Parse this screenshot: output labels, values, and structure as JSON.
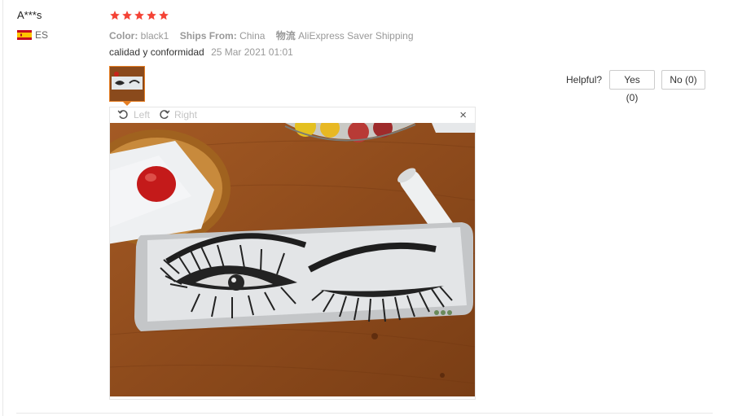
{
  "review": {
    "user_name": "A***s",
    "country_code": "ES",
    "rating": 5,
    "color_label": "Color:",
    "color_value": "black1",
    "ships_label": "Ships From:",
    "ships_value": "China",
    "shipping_label": "物流",
    "shipping_value": "AliExpress Saver Shipping",
    "text": "calidad y conformidad",
    "date": "25 Mar 2021 01:01",
    "helpful_label": "Helpful?",
    "yes_label": "Yes (0)",
    "no_label": "No (0)"
  },
  "viewer": {
    "rotate_left_label": "Left",
    "rotate_right_label": "Right",
    "close_label": "×"
  },
  "colors": {
    "star": "#f44336",
    "accent": "#e67e22",
    "muted_text": "#999999"
  },
  "icons": [
    "flag-spain-icon",
    "star-icon",
    "rotate-left-icon",
    "rotate-right-icon",
    "close-icon"
  ]
}
